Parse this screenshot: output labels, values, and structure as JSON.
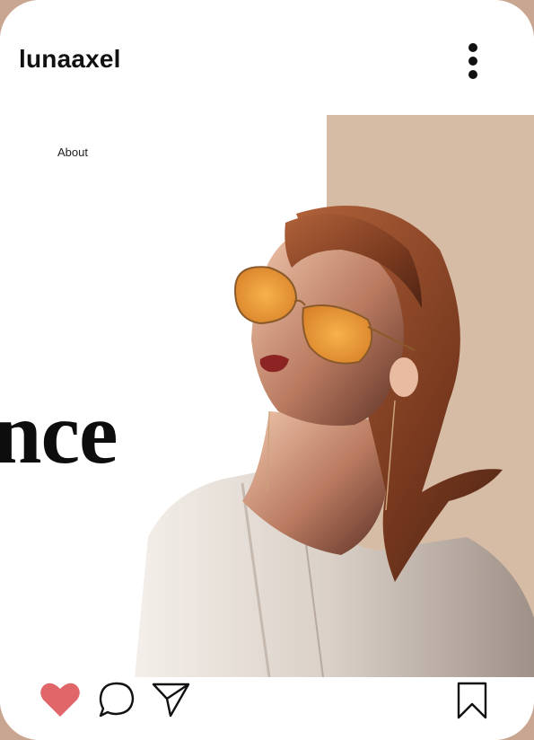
{
  "header": {
    "username": "lunaaxel",
    "more_icon": "vertical-ellipsis-icon"
  },
  "post": {
    "nav_link": "About",
    "headline_fragment": "nce",
    "photo_description_icon": "portrait-photo"
  },
  "actions": {
    "like_icon": "heart-icon",
    "like_color": "#e0666a",
    "comment_icon": "comment-icon",
    "share_icon": "send-icon",
    "save_icon": "bookmark-icon"
  },
  "colors": {
    "background": "#c9a691",
    "panel": "#d6bba5",
    "text": "#111111"
  }
}
